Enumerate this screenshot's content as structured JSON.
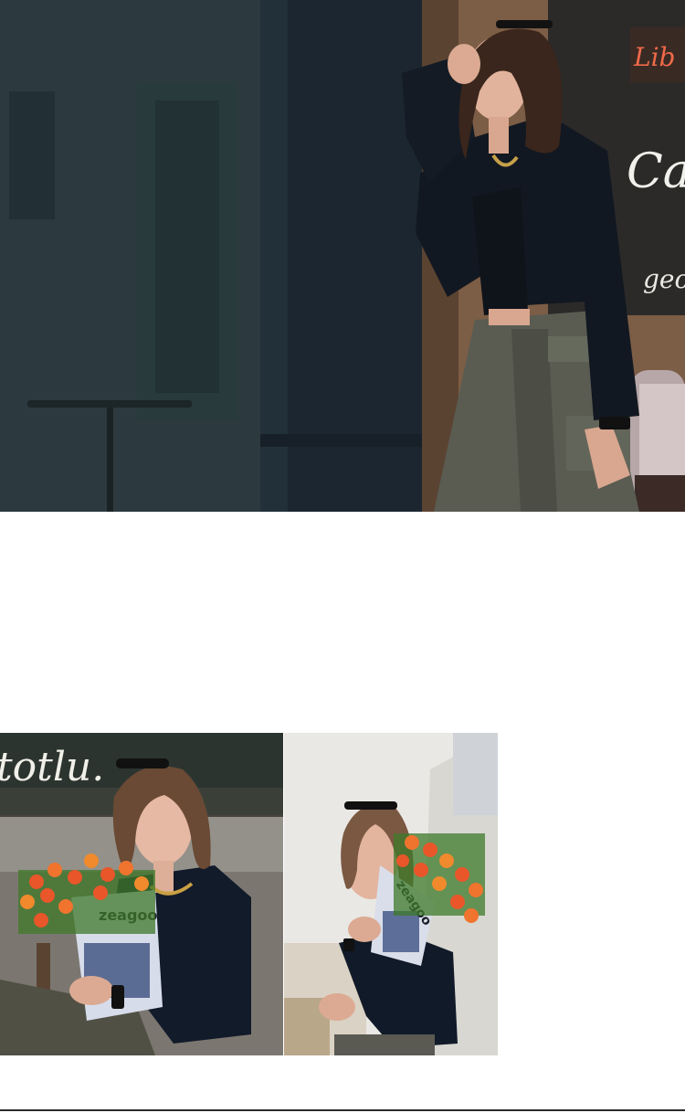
{
  "hero": {
    "sign_script_top": "Lib",
    "sign_cafe": "Cafe",
    "sign_geo": "geo"
  },
  "bottom_left": {
    "sign_text": "totlu.",
    "paper_brand": "zeagoo"
  },
  "bottom_right": {
    "paper_brand": "zeagoo"
  },
  "colors": {
    "jacket": "#121821",
    "pants": "#5a5c52",
    "flowers": "#e8562a",
    "rule": "#2b2b2b"
  }
}
